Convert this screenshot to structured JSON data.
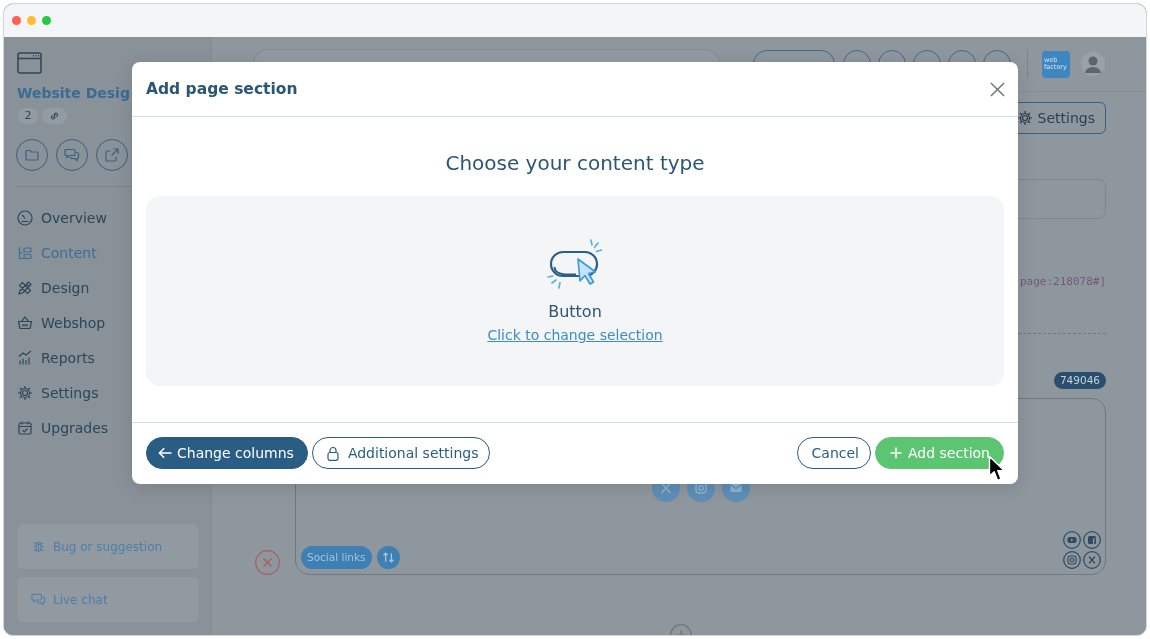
{
  "sidebar": {
    "title": "Website Desig",
    "count": "2",
    "nav": [
      {
        "label": "Overview",
        "selected": false
      },
      {
        "label": "Content",
        "selected": true
      },
      {
        "label": "Design",
        "selected": false
      },
      {
        "label": "Webshop",
        "selected": false
      },
      {
        "label": "Reports",
        "selected": false
      },
      {
        "label": "Settings",
        "selected": false
      },
      {
        "label": "Upgrades",
        "selected": false
      }
    ],
    "help_links": [
      "Bug or suggestion",
      "Live chat"
    ]
  },
  "header": {
    "logo_text": "web factory"
  },
  "editor": {
    "settings_button": "Settings",
    "code_line": "page:218078#]",
    "section_id": "749046",
    "section_tag": "Social links"
  },
  "modal": {
    "title": "Add page section",
    "heading": "Choose your content type",
    "selection": {
      "label": "Button",
      "link": "Click to change selection"
    },
    "buttons_left": [
      {
        "label": "Change columns",
        "kind": "back"
      },
      {
        "label": "Additional settings",
        "kind": "lock"
      }
    ],
    "buttons_right": [
      {
        "label": "Cancel",
        "kind": "cancel"
      },
      {
        "label": "Add section",
        "kind": "add"
      }
    ]
  }
}
